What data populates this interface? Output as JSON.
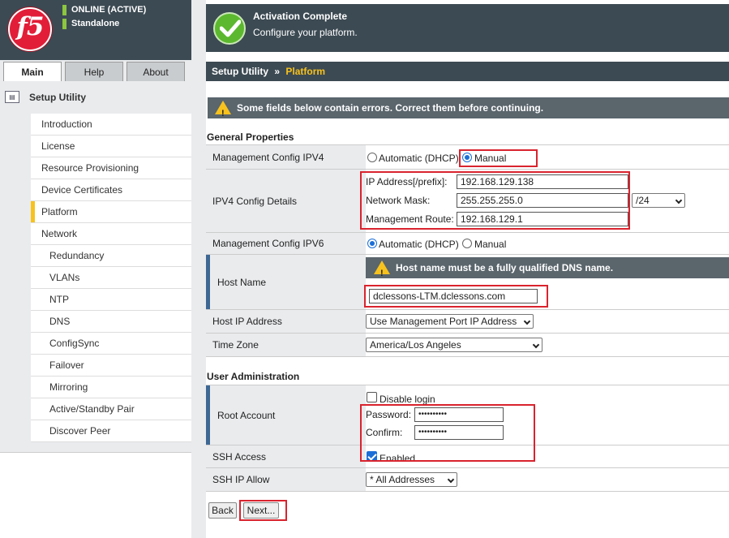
{
  "header": {
    "logo_text": "f5",
    "status_line1": "ONLINE (ACTIVE)",
    "status_line2": "Standalone",
    "activation_title": "Activation Complete",
    "activation_subtitle": "Configure your platform.",
    "status_color": "#8cc63f",
    "check_icon": "checkmark-icon"
  },
  "tabs": [
    {
      "label": "Main",
      "selected": true
    },
    {
      "label": "Help",
      "selected": false
    },
    {
      "label": "About",
      "selected": false
    }
  ],
  "sidebar": {
    "section_title": "Setup Utility",
    "items": [
      {
        "label": "Introduction",
        "indent": 0
      },
      {
        "label": "License",
        "indent": 0
      },
      {
        "label": "Resource Provisioning",
        "indent": 0
      },
      {
        "label": "Device Certificates",
        "indent": 0
      },
      {
        "label": "Platform",
        "indent": 0,
        "active": true
      },
      {
        "label": "Network",
        "indent": 0
      },
      {
        "label": "Redundancy",
        "indent": 1
      },
      {
        "label": "VLANs",
        "indent": 1
      },
      {
        "label": "NTP",
        "indent": 1
      },
      {
        "label": "DNS",
        "indent": 1
      },
      {
        "label": "ConfigSync",
        "indent": 1
      },
      {
        "label": "Failover",
        "indent": 1
      },
      {
        "label": "Mirroring",
        "indent": 1
      },
      {
        "label": "Active/Standby Pair",
        "indent": 1
      },
      {
        "label": "Discover Peer",
        "indent": 1
      }
    ]
  },
  "breadcrumb": {
    "parent": "Setup Utility",
    "separator": "»",
    "current": "Platform"
  },
  "error_message": "Some fields below contain errors. Correct them before continuing.",
  "general": {
    "title": "General Properties",
    "mgmt_ipv4": {
      "label": "Management Config IPV4",
      "option_auto": "Automatic (DHCP)",
      "option_manual": "Manual",
      "selected": "Manual"
    },
    "ipv4_details": {
      "label": "IPV4 Config Details",
      "ip_label": "IP Address[/prefix]:",
      "ip_value": "192.168.129.138",
      "mask_label": "Network Mask:",
      "mask_value": "255.255.255.0",
      "prefix_value": "/24",
      "route_label": "Management Route:",
      "route_value": "192.168.129.1"
    },
    "mgmt_ipv6": {
      "label": "Management Config IPV6",
      "option_auto": "Automatic (DHCP)",
      "option_manual": "Manual",
      "selected": "Automatic (DHCP)"
    },
    "host_name": {
      "label": "Host Name",
      "warning": "Host name must be a fully qualified DNS name.",
      "value": "dclessons-LTM.dclessons.com"
    },
    "host_ip": {
      "label": "Host IP Address",
      "value": "Use Management Port IP Address"
    },
    "time_zone": {
      "label": "Time Zone",
      "value": "America/Los Angeles"
    }
  },
  "user_admin": {
    "title": "User Administration",
    "root": {
      "label": "Root Account",
      "disable_login": "Disable login",
      "disable_checked": false,
      "password_label": "Password:",
      "password_value": "••••••••••",
      "confirm_label": "Confirm:",
      "confirm_value": "••••••••••"
    },
    "ssh_access": {
      "label": "SSH Access",
      "enabled_label": "Enabled",
      "checked": true
    },
    "ssh_ip_allow": {
      "label": "SSH IP Allow",
      "value": "* All Addresses"
    }
  },
  "buttons": {
    "back": "Back",
    "next": "Next..."
  },
  "colors": {
    "header_bg": "#3c4a53",
    "accent_yellow": "#f7c21e",
    "error_red": "#d9232e",
    "required_blue": "#3e6894"
  }
}
